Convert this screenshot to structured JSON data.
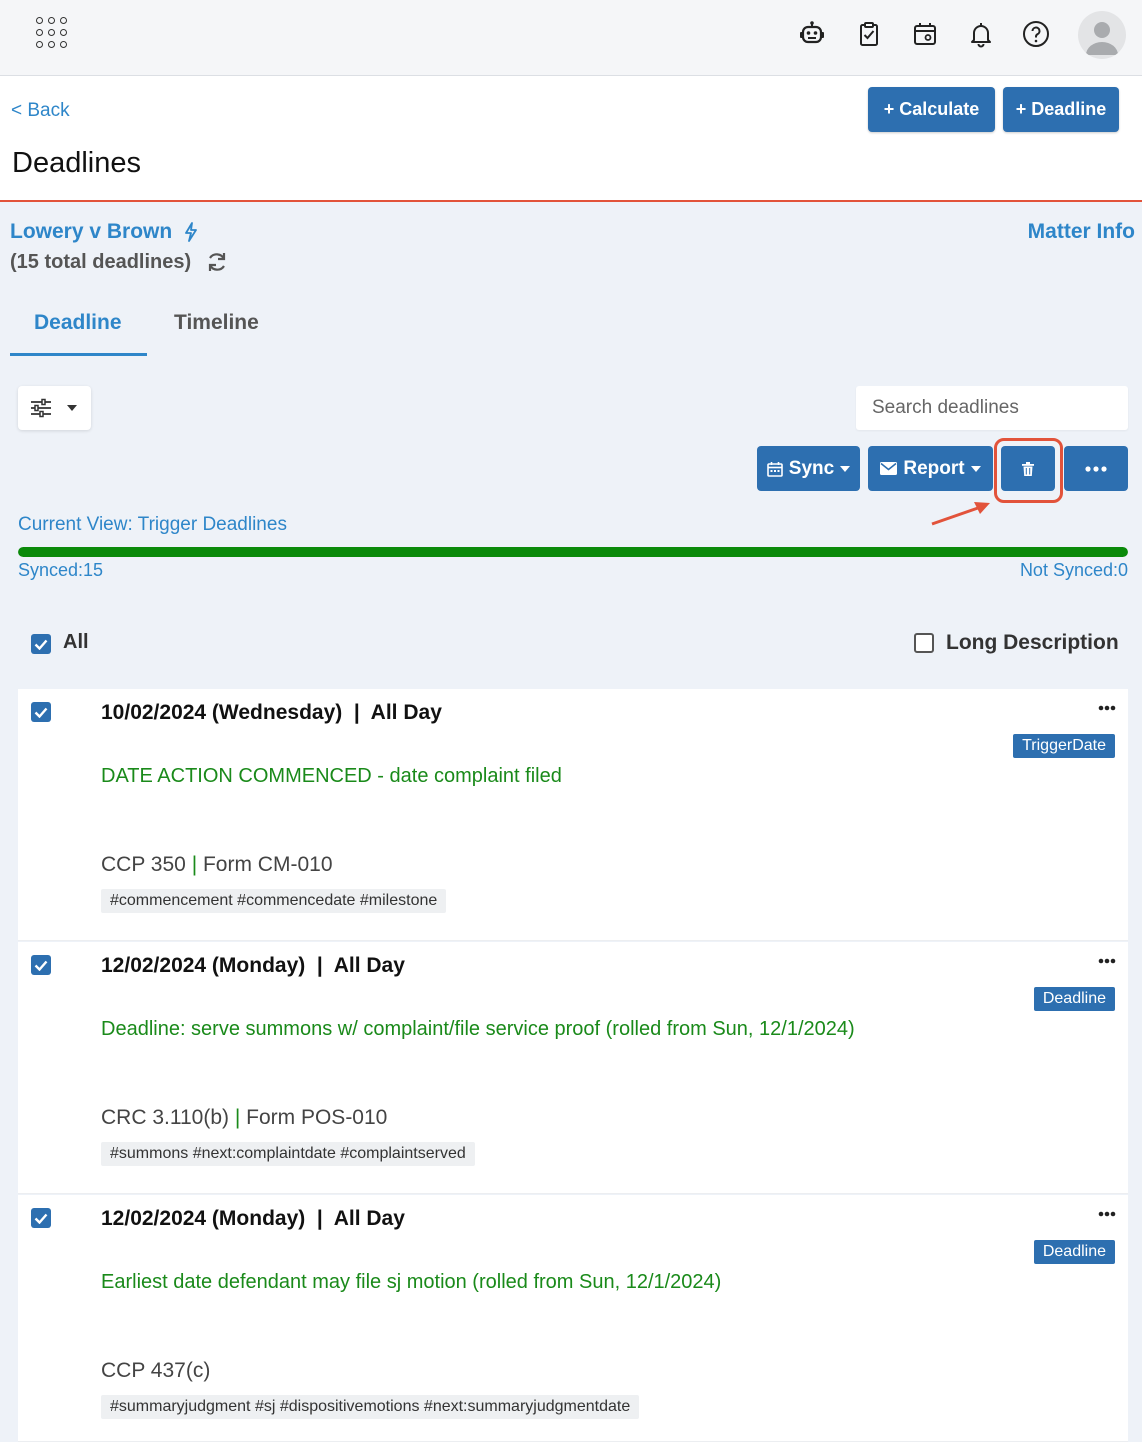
{
  "header": {
    "back_label": "< Back",
    "title": "Deadlines",
    "calculate_label": "+ Calculate",
    "deadline_label": "+ Deadline"
  },
  "matter": {
    "name": "Lowery v Brown",
    "total": "(15 total deadlines)",
    "info_label": "Matter Info"
  },
  "tabs": [
    {
      "label": "Deadline",
      "active": true
    },
    {
      "label": "Timeline",
      "active": false
    }
  ],
  "search": {
    "placeholder": "Search deadlines"
  },
  "actions": {
    "sync_label": "Sync",
    "report_label": "Report"
  },
  "view": {
    "current": "Current View: Trigger Deadlines",
    "synced": "Synced:15",
    "not_synced": "Not Synced:0",
    "synced_fraction": 1.0
  },
  "list": {
    "all_label": "All",
    "long_desc_label": "Long Description"
  },
  "deadlines": [
    {
      "date": "10/02/2024 (Wednesday)  |  All Day",
      "badge": "TriggerDate",
      "description": "DATE ACTION COMMENCED - date complaint filed",
      "rule": "CCP 350",
      "form": "Form CM-010",
      "tags": "#commencement #commencedate #milestone"
    },
    {
      "date": "12/02/2024 (Monday)  |  All Day",
      "badge": "Deadline",
      "description": "Deadline: serve summons w/ complaint/file service proof (rolled from Sun, 12/1/2024)",
      "rule": "CRC 3.110(b)",
      "form": "Form POS-010",
      "tags": "#summons #next:complaintdate #complaintserved"
    },
    {
      "date": "12/02/2024 (Monday)  |  All Day",
      "badge": "Deadline",
      "description": "Earliest date defendant may file sj motion (rolled from Sun, 12/1/2024)",
      "rule": "CCP 437(c)",
      "form": "",
      "tags": "#summaryjudgment #sj #dispositivemotions #next:summaryjudgmentdate"
    }
  ],
  "colors": {
    "accent": "#2e86c9",
    "button": "#2d6fb0",
    "header_rule": "#e2533b",
    "progress": "#0a8a0a",
    "description": "#1a8a1a"
  },
  "icons": [
    "apps-grid-icon",
    "robot-icon",
    "clipboard-check-icon",
    "calendar-icon",
    "bell-icon",
    "help-icon",
    "avatar-icon",
    "bolt-icon",
    "refresh-icon",
    "sliders-icon",
    "trash-icon",
    "ellipsis-icon"
  ]
}
